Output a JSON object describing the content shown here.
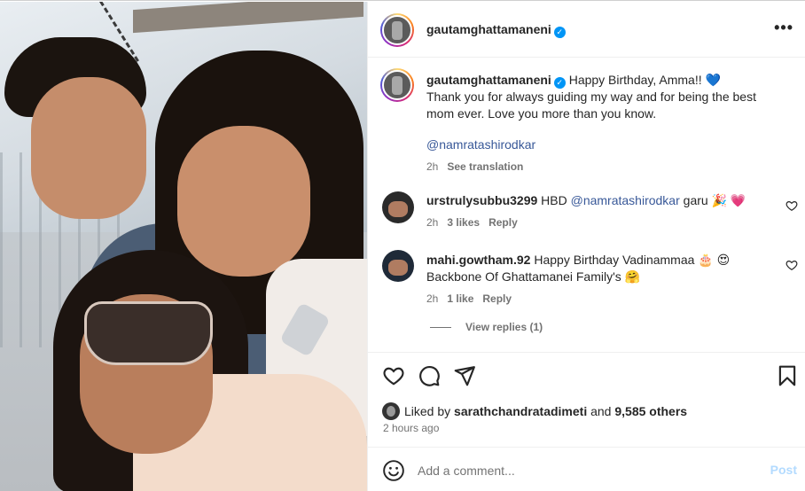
{
  "post": {
    "author": "gautamghattamaneni",
    "verified_icon": "verified-badge-icon",
    "more_icon": "more-options-icon"
  },
  "caption": {
    "username": "gautamghattamaneni",
    "text_line1": "Happy Birthday, Amma!! 💙",
    "text_line2": "Thank you for always guiding my way and for being the best mom ever. Love you more than you know.",
    "mention": "@namratashirodkar",
    "time": "2h",
    "see_translation": "See translation"
  },
  "comments": [
    {
      "username": "urstrulysubbu3299",
      "text_prefix": "HBD",
      "mention": "@namratashirodkar",
      "text_suffix": "garu 🎉 💗",
      "time": "2h",
      "likes": "3 likes",
      "reply": "Reply"
    },
    {
      "username": "mahi.gowtham.92",
      "text": "Happy Birthday Vadinammaa 🎂 😍 Backbone Of Ghattamanei Family's 🤗",
      "time": "2h",
      "likes": "1 like",
      "reply": "Reply",
      "view_replies": "View replies (1)"
    }
  ],
  "engagement": {
    "liked_by_prefix": "Liked by",
    "liked_by_user": "sarathchandratadimeti",
    "and": "and",
    "others": "9,585 others",
    "time_ago": "2 hours ago"
  },
  "add_comment": {
    "placeholder": "Add a comment...",
    "post_label": "Post"
  },
  "colors": {
    "accent": "#0095f6",
    "muted": "#737373",
    "mention": "#385898",
    "post_disabled": "#b3dbff"
  }
}
